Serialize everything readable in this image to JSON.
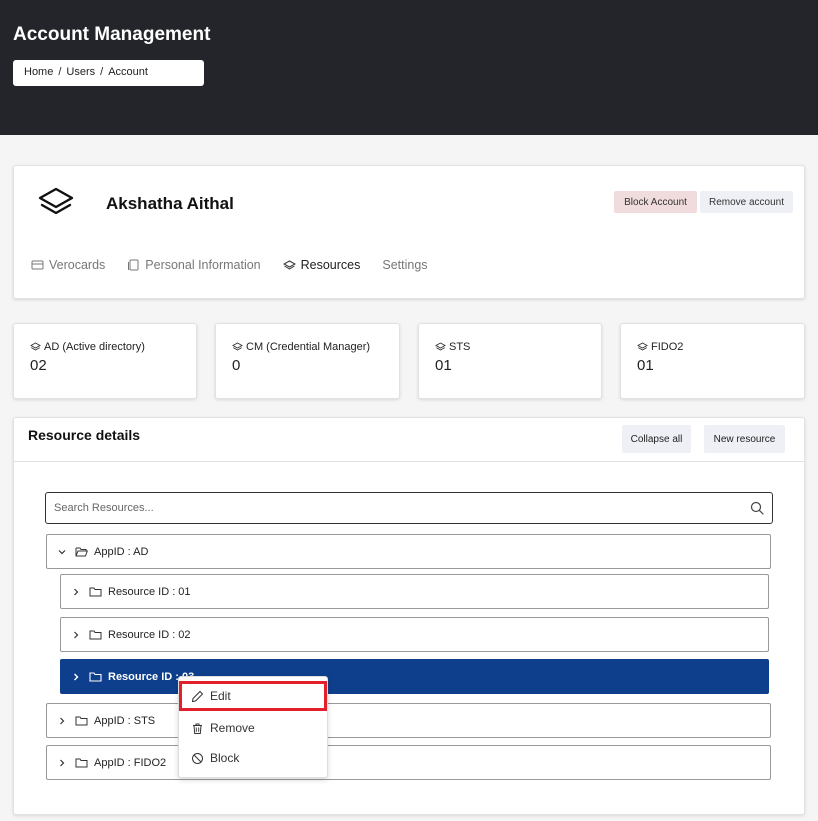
{
  "header": {
    "title": "Account Management",
    "breadcrumb": [
      "Home",
      "Users",
      "Account"
    ],
    "breadcrumb_separator": "/"
  },
  "profile": {
    "name": "Akshatha Aithal",
    "logo_icon": "layers-icon",
    "actions": {
      "block_label": "Block Account",
      "remove_label": "Remove account"
    },
    "tabs": [
      {
        "label": "Verocards",
        "icon": "card-icon",
        "active": false
      },
      {
        "label": "Personal Information",
        "icon": "document-icon",
        "active": false
      },
      {
        "label": "Resources",
        "icon": "layers-icon",
        "active": true
      },
      {
        "label": "Settings",
        "icon": "",
        "active": false
      }
    ]
  },
  "stats": [
    {
      "label": "AD (Active directory)",
      "value": "02",
      "icon": "layers-icon"
    },
    {
      "label": "CM (Credential Manager)",
      "value": "0",
      "icon": "layers-icon"
    },
    {
      "label": "STS",
      "value": "01",
      "icon": "layers-icon"
    },
    {
      "label": "FIDO2",
      "value": "01",
      "icon": "layers-icon"
    }
  ],
  "resources": {
    "title": "Resource details",
    "collapse_label": "Collapse all",
    "new_label": "New resource",
    "search_placeholder": "Search Resources...",
    "tree": [
      {
        "label": "AppID : AD",
        "expanded": true,
        "level": 0
      },
      {
        "label": "Resource ID : 01",
        "expanded": false,
        "level": 1
      },
      {
        "label": "Resource ID : 02",
        "expanded": false,
        "level": 1
      },
      {
        "label": "Resource ID : 03",
        "expanded": false,
        "level": 1,
        "selected": true
      },
      {
        "label": "AppID : STS",
        "expanded": false,
        "level": 0
      },
      {
        "label": "AppID : FIDO2",
        "expanded": false,
        "level": 0
      }
    ]
  },
  "context_menu": {
    "items": [
      {
        "label": "Edit",
        "icon": "pencil-icon",
        "highlighted": true
      },
      {
        "label": "Remove",
        "icon": "trash-icon"
      },
      {
        "label": "Block",
        "icon": "block-icon"
      }
    ]
  },
  "colors": {
    "topbar": "#23252b",
    "selected_row": "#0e3f8c",
    "highlight_outline": "#e0202a",
    "block_button": "#f0dcdc"
  }
}
